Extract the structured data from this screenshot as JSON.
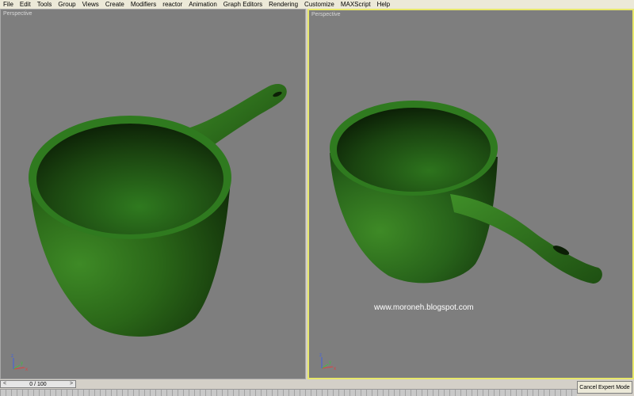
{
  "menu": [
    "File",
    "Edit",
    "Tools",
    "Group",
    "Views",
    "Create",
    "Modifiers",
    "reactor",
    "Animation",
    "Graph Editors",
    "Rendering",
    "Customize",
    "MAXScript",
    "Help"
  ],
  "viewports": {
    "left": {
      "label": "Perspective"
    },
    "right": {
      "label": "Perspective",
      "watermark": "www.moroneh.blogspot.com"
    }
  },
  "axis": {
    "x": "x",
    "y": "y",
    "z": "z"
  },
  "timeline": {
    "frame_label": "0 / 100",
    "prev": "<",
    "next": ">"
  },
  "expert_mode_button": "Cancel Expert Mode",
  "colors": {
    "viewport_bg": "#7e7e7e",
    "object": "#2e6e1c",
    "active_border": "#e8e86a"
  }
}
